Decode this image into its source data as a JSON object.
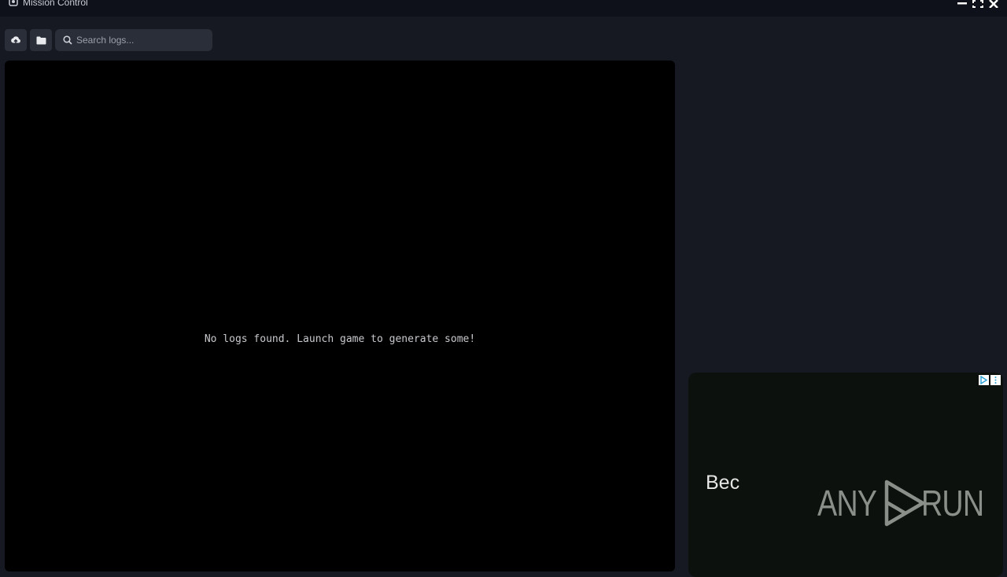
{
  "window": {
    "title": "Mission Control"
  },
  "toolbar": {
    "upload_icon": "cloud-upload-icon",
    "folder_icon": "folder-icon",
    "search_placeholder": "Search logs..."
  },
  "log_panel": {
    "empty_message": "No logs found. Launch game to generate some!"
  },
  "ad": {
    "text": "Bec",
    "logo_left": "ANY",
    "logo_right": "RUN"
  },
  "colors": {
    "background": "#161922",
    "titlebar": "#0e1119",
    "panel": "#000000",
    "button": "#2a2e38"
  }
}
